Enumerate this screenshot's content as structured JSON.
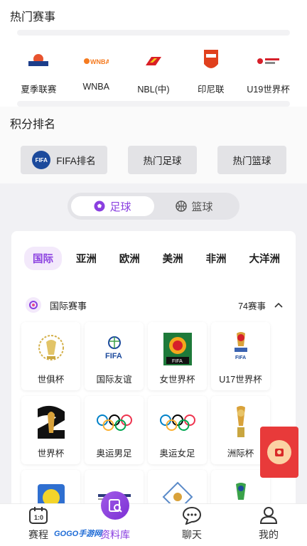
{
  "hot_section": {
    "title": "热门赛事",
    "leagues": [
      {
        "label": "夏季联赛",
        "icon": "summer-league-logo"
      },
      {
        "label": "WNBA",
        "icon": "wnba-logo"
      },
      {
        "label": "NBL(中)",
        "icon": "nbl-logo"
      },
      {
        "label": "印尼联",
        "icon": "indonesian-league-logo"
      },
      {
        "label": "U19世界杯",
        "icon": "u19-world-cup-logo"
      }
    ]
  },
  "rank_section": {
    "title": "积分排名",
    "buttons": [
      {
        "label": "FIFA排名",
        "badge": "FIFA"
      },
      {
        "label": "热门足球"
      },
      {
        "label": "热门篮球"
      }
    ]
  },
  "sport_toggle": {
    "options": [
      {
        "label": "足球",
        "active": true
      },
      {
        "label": "篮球",
        "active": false
      }
    ]
  },
  "region_tabs": [
    {
      "label": "国际",
      "active": true
    },
    {
      "label": "亚洲"
    },
    {
      "label": "欧洲"
    },
    {
      "label": "美洲"
    },
    {
      "label": "非洲"
    },
    {
      "label": "大洋洲"
    }
  ],
  "competition_group": {
    "label": "国际赛事",
    "count": "74赛事"
  },
  "competitions": [
    {
      "label": "世俱杯",
      "icon": "club-world-cup-logo"
    },
    {
      "label": "国际友谊",
      "icon": "fifa-friendly-logo",
      "logo_text": "FIFA"
    },
    {
      "label": "女世界杯",
      "icon": "womens-world-cup-logo",
      "logo_text": "FIFA"
    },
    {
      "label": "U17世界杯",
      "icon": "u17-world-cup-logo",
      "logo_text": "FIFA"
    },
    {
      "label": "世界杯",
      "icon": "world-cup-logo"
    },
    {
      "label": "奥运男足",
      "icon": "olympic-rings-icon"
    },
    {
      "label": "奥运女足",
      "icon": "olympic-rings-icon"
    },
    {
      "label": "洲际杯",
      "icon": "intercontinental-cup-logo"
    },
    {
      "label": "",
      "icon": "partial-logo-1"
    },
    {
      "label": "",
      "icon": "pinatar-cup-logo"
    },
    {
      "label": "",
      "icon": "partial-logo-3"
    },
    {
      "label": "",
      "icon": "partial-logo-4"
    }
  ],
  "bottom_nav": [
    {
      "label": "赛程",
      "icon": "schedule-icon"
    },
    {
      "label": "资料库",
      "icon": "database-icon",
      "active": true
    },
    {
      "label": "聊天",
      "icon": "chat-icon"
    },
    {
      "label": "我的",
      "icon": "profile-icon"
    }
  ],
  "watermark": "GOGO手游网",
  "colors": {
    "accent": "#8a3fe0",
    "redpacket": "#e83a3a",
    "fifa_blue": "#1c4a9c"
  }
}
